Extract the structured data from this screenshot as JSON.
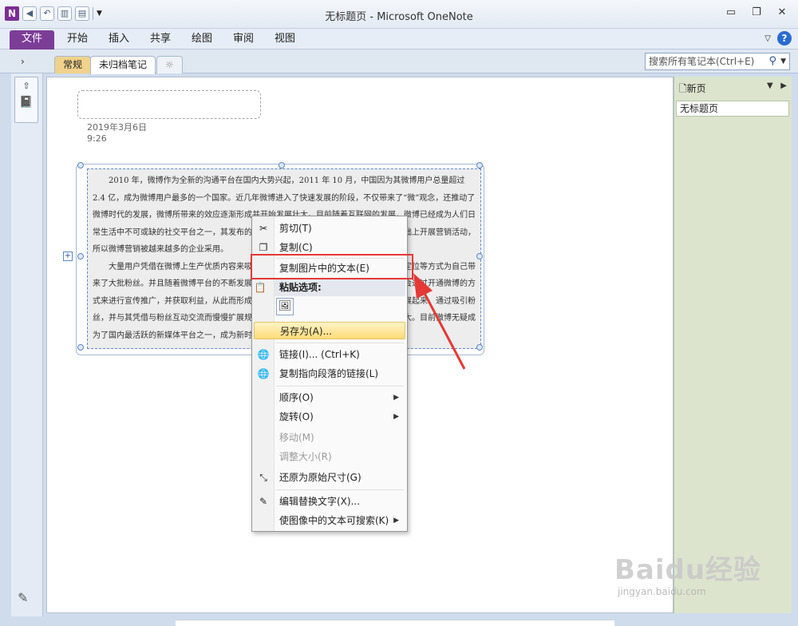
{
  "window": {
    "title": "无标题页 - Microsoft OneNote",
    "app_logo": "N",
    "controls": {
      "minimize": "▭",
      "restore": "❐",
      "close": "✕"
    }
  },
  "ribbon": {
    "tabs": [
      "文件",
      "开始",
      "插入",
      "共享",
      "绘图",
      "审阅",
      "视图"
    ],
    "help": "?"
  },
  "notebook_bar": {
    "collapse": "›",
    "section_tabs": [
      "常规",
      "未归档笔记",
      "☼"
    ],
    "search_placeholder": "搜索所有笔记本(Ctrl+E)",
    "search_icon": "⚲"
  },
  "page": {
    "date": "2019年3月6日",
    "time": "9:26",
    "picture_text": [
      "2010 年，微博作为全新的沟通平台在国内大势兴起，2011 年 10 月，中国因为其微博用户总量超过 2.4 亿，成为微博用户最多的一个国家。近几年微博进入了快速发展的阶段，不仅带来了“微”观念，还推动了微博时代的发展，微博所带来的效应逐渐形成并开始发展壮大。目前随着互联网的发展，微博已经成为人们日常生活中不可或缺的社交平台之一，其发布的信息还可产生病毒式传播效果，企业在此基础上开展营销活动，所以微博营销被越来越多的企业采用。",
      "大量用户凭借在微博上生产优质内容来吸引粉丝，并通过广告推广等方式实现其目标定位等方式为自己带来了大批粉丝。并且随着微博平台的不断发展，用户规模的不断扩大，大多数企业或个人会通过开通微博的方式来进行宣传推广，并获取利益，从此而形成一种粉丝经济模式。这样的一种模式逐渐发展起来，通过吸引粉丝，并与其凭借与粉丝互动交流而慢慢扩展规模，逐渐形成一种新的营销方式，并发展壮大。目前微博无疑成为了国内最活跃的新媒体平台之一，成为新时代下一种重要的营销方式。"
    ]
  },
  "pages_panel": {
    "new_page": "新页",
    "pages": [
      "无标题页"
    ]
  },
  "context_menu": {
    "cut": "剪切(T)",
    "copy": "复制(C)",
    "copy_text_from_picture": "复制图片中的文本(E)",
    "paste_options": "粘贴选项:",
    "save_as": "另存为(A)...",
    "link": "链接(I)...  (Ctrl+K)",
    "copy_link_to_paragraph": "复制指向段落的链接(L)",
    "order": "顺序(O)",
    "rotate": "旋转(O)",
    "move": "移动(M)",
    "resize": "调整大小(R)",
    "restore_original_size": "还原为原始尺寸(G)",
    "edit_alt_text": "编辑替换文字(X)...",
    "make_text_searchable": "使图像中的文本可搜索(K)"
  },
  "watermark": {
    "logo": "Baidu经验",
    "url": "jingyan.baidu.com"
  },
  "colors": {
    "file_tab": "#7c3d97",
    "annotation_red": "#e53935",
    "pages_panel": "#dce4cd",
    "highlight": "#fddc78"
  }
}
